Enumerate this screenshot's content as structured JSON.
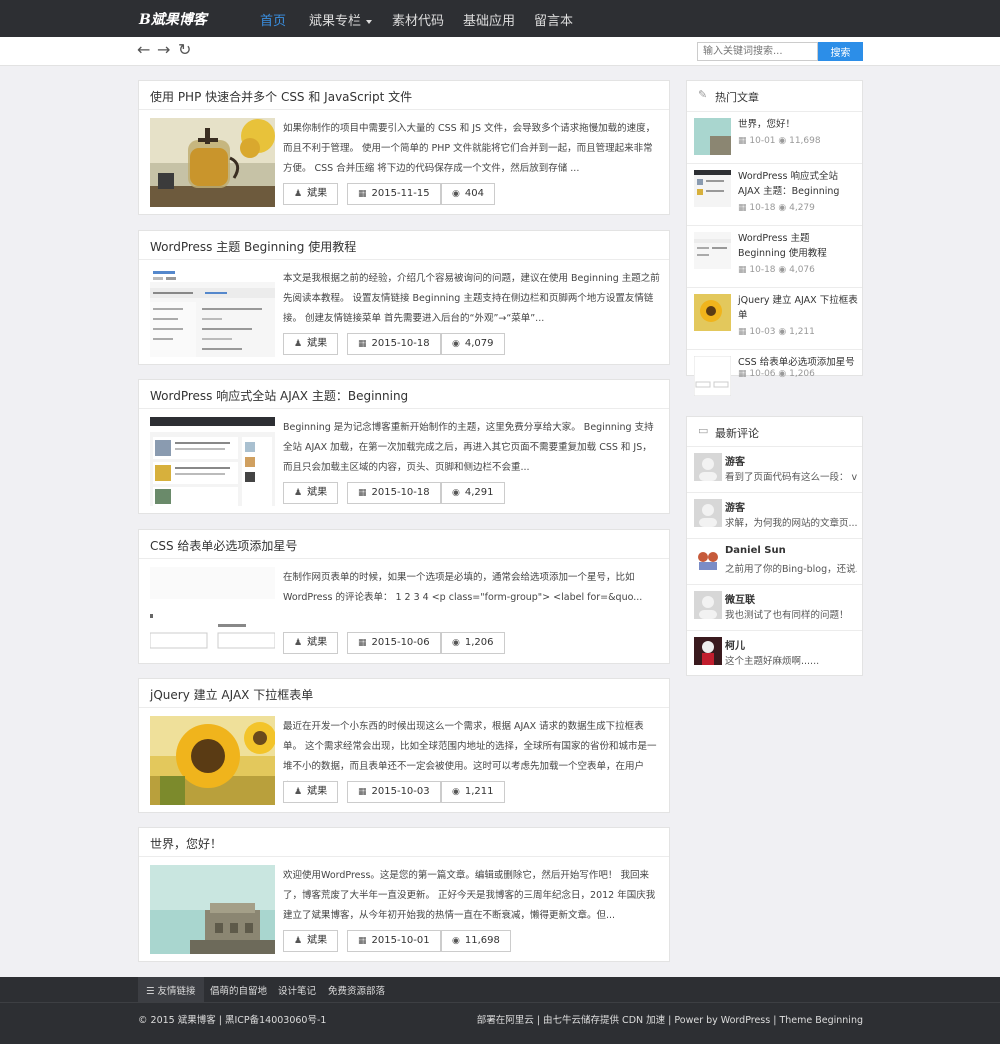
{
  "nav": {
    "logo": "B斌果博客",
    "items": [
      {
        "label": "首页"
      },
      {
        "label": "斌果专栏"
      },
      {
        "label": "素材代码"
      },
      {
        "label": "基础应用"
      },
      {
        "label": "留言本"
      }
    ]
  },
  "toolbar": {
    "back_icon": "←",
    "forward_icon": "→",
    "refresh_icon": "↻",
    "search_placeholder": "输入关键词搜索...",
    "search_button": "搜索"
  },
  "posts": [
    {
      "title": "使用 PHP 快速合并多个 CSS 和 JavaScript 文件",
      "excerpt": "如果你制作的项目中需要引入大量的 CSS 和 JS 文件，会导致多个请求拖慢加载的速度，而且不利于管理。 使用一个简单的 PHP 文件就能将它们合并到一起，而且管理起来非常方便。 CSS 合并压缩 将下边的代码保存成一个文件，然后放到存储 ...",
      "author": "斌果",
      "date": "2015-11-15",
      "views": "404"
    },
    {
      "title": "WordPress 主题 Beginning 使用教程",
      "excerpt": "本文是我根据之前的经验，介绍几个容易被询问的问题，建议在使用 Beginning 主题之前先阅读本教程。 设置友情链接 Beginning 主题支持在侧边栏和页脚两个地方设置友情链接。 创建友情链接菜单 首先需要进入后台的“外观”→“菜单”...",
      "author": "斌果",
      "date": "2015-10-18",
      "views": "4,079"
    },
    {
      "title": "WordPress 响应式全站 AJAX 主题：Beginning",
      "excerpt": "Beginning 是为记念博客重新开始制作的主题，这里免费分享给大家。 Beginning 支持全站 AJAX 加载，在第一次加载完成之后，再进入其它页面不需要重复加载 CSS 和 JS，而且只会加载主区域的内容，页头、页脚和侧边栏不会重...",
      "author": "斌果",
      "date": "2015-10-18",
      "views": "4,291"
    },
    {
      "title": "CSS 给表单必选项添加星号",
      "excerpt": "在制作网页表单的时候，如果一个选项是必填的，通常会给选项添加一个星号，比如 WordPress 的评论表单： 1 2 3 4 <p class=\"form-group\"> <label for=&quo...",
      "author": "斌果",
      "date": "2015-10-06",
      "views": "1,206"
    },
    {
      "title": "jQuery 建立 AJAX 下拉框表单",
      "excerpt": "最近在开发一个小东西的时候出现这么一个需求，根据 AJAX 请求的数据生成下拉框表单。 这个需求经常会出现，比如全球范围内地址的选择，全球所有国家的省份和城市是一堆不小的数据，而且表单还不一定会被使用。这时可以考虑先加载一个空表单，在用户点...",
      "author": "斌果",
      "date": "2015-10-03",
      "views": "1,211"
    },
    {
      "title": "世界，您好！",
      "excerpt": "欢迎使用WordPress。这是您的第一篇文章。编辑或删除它，然后开始写作吧！ 我回来了，博客荒废了大半年一直没更新。 正好今天是我博客的三周年纪念日，2012 年国庆我建立了斌果博客，从今年初开始我的热情一直在不断衰减，懒得更新文章。但...",
      "author": "斌果",
      "date": "2015-10-01",
      "views": "11,698"
    }
  ],
  "sidebar": {
    "hot_title": "热门文章",
    "hot": [
      {
        "title": "世界，您好！",
        "date": "10-01",
        "views": "11,698"
      },
      {
        "title": "WordPress 响应式全站 AJAX 主题：Beginning",
        "date": "10-18",
        "views": "4,279"
      },
      {
        "title": "WordPress 主题 Beginning 使用教程",
        "date": "10-18",
        "views": "4,076"
      },
      {
        "title": "jQuery 建立 AJAX 下拉框表单",
        "date": "10-03",
        "views": "1,211"
      },
      {
        "title": "CSS 给表单必选项添加星号",
        "date": "10-06",
        "views": "1,206"
      }
    ],
    "comments_title": "最新评论",
    "comments": [
      {
        "name": "游客",
        "text": "看到了页面代码有这么一段： v..."
      },
      {
        "name": "游客",
        "text": "求解，为何我的网站的文章页..."
      },
      {
        "name": "Daniel Sun",
        "text": "之前用了你的Bing-blog，还说..."
      },
      {
        "name": "微互联",
        "text": "我也测试了也有同样的问题！"
      },
      {
        "name": "柯儿",
        "text": "这个主题好麻烦啊......"
      }
    ]
  },
  "footer": {
    "links_label": "友情链接",
    "links": [
      "倡萌的自留地",
      "设计笔记",
      "免费资源部落"
    ],
    "copyright": "© 2015 斌果博客 | 黑ICP备14003060号-1",
    "credit": "部署在阿里云 | 由七牛云储存提供 CDN 加速 | Power by WordPress | Theme Beginning"
  }
}
